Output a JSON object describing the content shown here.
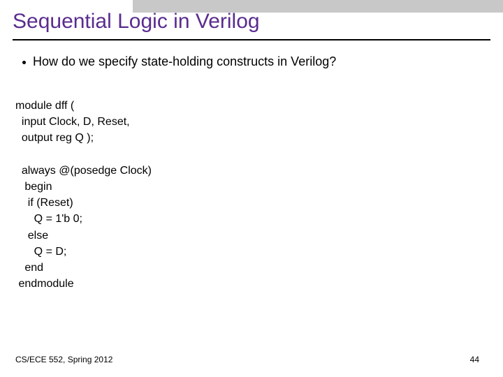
{
  "title": "Sequential Logic in Verilog",
  "bullet": "How do we specify state-holding constructs in Verilog?",
  "code": "module dff (\n  input Clock, D, Reset,\n  output reg Q );\n\n  always @(posedge Clock)\n   begin\n    if (Reset)\n      Q = 1'b 0;\n    else\n      Q = D;\n   end\n endmodule",
  "footer_left": "CS/ECE 552, Spring 2012",
  "footer_right": "44"
}
